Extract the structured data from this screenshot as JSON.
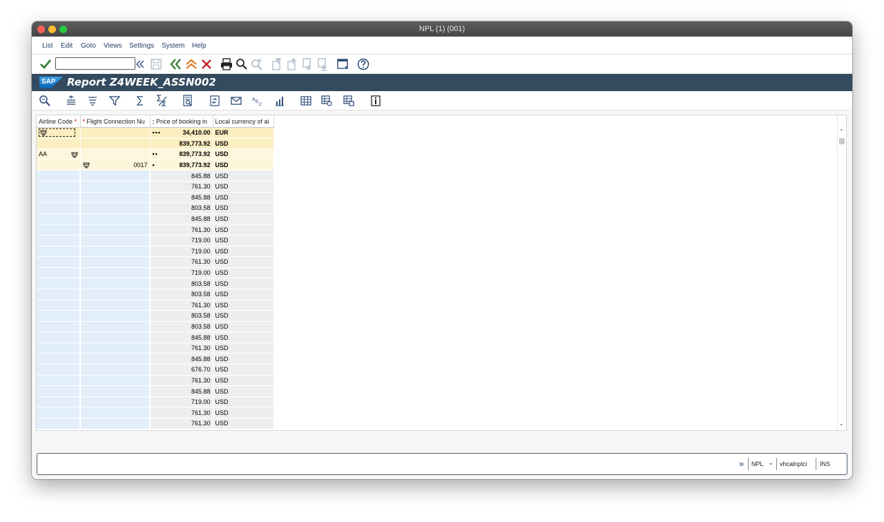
{
  "window": {
    "title": "NPL (1) (001)"
  },
  "menu": [
    "List",
    "Edit",
    "Goto",
    "Views",
    "Settings",
    "System",
    "Help"
  ],
  "toolbar": {
    "command_value": ""
  },
  "banner": {
    "logo": "SAP",
    "title": "Report Z4WEEK_ASSN002"
  },
  "grid": {
    "headers": [
      "Airline Code",
      "Flight Connection Nu",
      "Price of booking in",
      "Local currency of ai"
    ],
    "summary_rows": [
      {
        "airline": "",
        "connection": "",
        "dots": "▪▪▪",
        "price": "34,410.00",
        "currency": "EUR",
        "icon_airline": true
      },
      {
        "airline": "",
        "connection": "",
        "dots": "",
        "price": "839,773.92",
        "currency": "USD"
      },
      {
        "airline": "AA",
        "connection": "",
        "dots": "▪▪",
        "price": "839,773.92",
        "currency": "USD",
        "icon_airline_right": true
      },
      {
        "airline": "",
        "connection": "0017",
        "dots": "▪",
        "price": "839,773.92",
        "currency": "USD",
        "icon_connection": true
      }
    ],
    "data_rows": [
      {
        "price": "845.88",
        "currency": "USD"
      },
      {
        "price": "761.30",
        "currency": "USD"
      },
      {
        "price": "845.88",
        "currency": "USD"
      },
      {
        "price": "803.58",
        "currency": "USD"
      },
      {
        "price": "845.88",
        "currency": "USD"
      },
      {
        "price": "761.30",
        "currency": "USD"
      },
      {
        "price": "719.00",
        "currency": "USD"
      },
      {
        "price": "719.00",
        "currency": "USD"
      },
      {
        "price": "761.30",
        "currency": "USD"
      },
      {
        "price": "719.00",
        "currency": "USD"
      },
      {
        "price": "803.58",
        "currency": "USD"
      },
      {
        "price": "803.58",
        "currency": "USD"
      },
      {
        "price": "761.30",
        "currency": "USD"
      },
      {
        "price": "803.58",
        "currency": "USD"
      },
      {
        "price": "803.58",
        "currency": "USD"
      },
      {
        "price": "845.88",
        "currency": "USD"
      },
      {
        "price": "761.30",
        "currency": "USD"
      },
      {
        "price": "845.88",
        "currency": "USD"
      },
      {
        "price": "676.70",
        "currency": "USD"
      },
      {
        "price": "761.30",
        "currency": "USD"
      },
      {
        "price": "845.88",
        "currency": "USD"
      },
      {
        "price": "719.00",
        "currency": "USD"
      },
      {
        "price": "761.30",
        "currency": "USD"
      },
      {
        "price": "761.30",
        "currency": "USD"
      }
    ]
  },
  "status": {
    "system": "NPL",
    "server": "vhcalnplci",
    "mode": "INS"
  }
}
